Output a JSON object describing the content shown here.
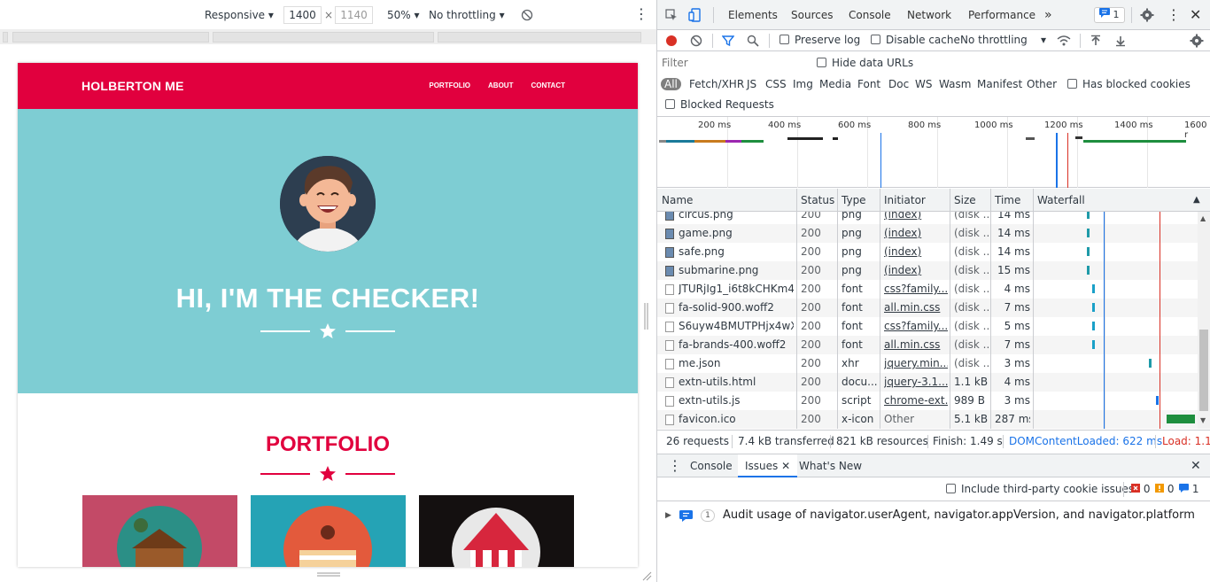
{
  "device_toolbar": {
    "mode": "Responsive",
    "width": "1400",
    "height": "1140",
    "times": "×",
    "zoom": "50%",
    "throttling": "No throttling"
  },
  "site": {
    "brand": "HOLBERTON ME",
    "nav": [
      "PORTFOLIO",
      "ABOUT",
      "CONTACT"
    ],
    "hero_title": "HI, I'M THE CHECKER!",
    "portfolio_title": "PORTFOLIO",
    "colors": {
      "primary": "#e1003e",
      "hero": "#7ecdd3"
    }
  },
  "devtools": {
    "tabs": [
      "Elements",
      "Sources",
      "Console",
      "Network",
      "Performance"
    ],
    "active_tab": "Network",
    "more_tabs": "»",
    "issues_badge": "1",
    "toolbar": {
      "preserve_log": "Preserve log",
      "disable_cache": "Disable cache",
      "throttling": "No throttling"
    },
    "filter": {
      "placeholder": "Filter",
      "hide_data_urls": "Hide data URLs",
      "types": [
        "All",
        "Fetch/XHR",
        "JS",
        "CSS",
        "Img",
        "Media",
        "Font",
        "Doc",
        "WS",
        "Wasm",
        "Manifest",
        "Other"
      ],
      "has_blocked_cookies": "Has blocked cookies",
      "blocked_requests": "Blocked Requests"
    },
    "overview_ticks": [
      "200 ms",
      "400 ms",
      "600 ms",
      "800 ms",
      "1000 ms",
      "1200 ms",
      "1400 ms",
      "1600 r"
    ],
    "columns": [
      "Name",
      "Status",
      "Type",
      "Initiator",
      "Size",
      "Time",
      "Waterfall"
    ],
    "rows": [
      {
        "name": "circus.png",
        "status": "200",
        "type": "png",
        "initiator": "(index)",
        "size": "(disk ...",
        "time": "14 ms"
      },
      {
        "name": "game.png",
        "status": "200",
        "type": "png",
        "initiator": "(index)",
        "size": "(disk ...",
        "time": "14 ms"
      },
      {
        "name": "safe.png",
        "status": "200",
        "type": "png",
        "initiator": "(index)",
        "size": "(disk ...",
        "time": "14 ms"
      },
      {
        "name": "submarine.png",
        "status": "200",
        "type": "png",
        "initiator": "(index)",
        "size": "(disk ...",
        "time": "15 ms"
      },
      {
        "name": "JTURjIg1_i6t8kCHKm4...",
        "status": "200",
        "type": "font",
        "initiator": "css?family...",
        "size": "(disk ...",
        "time": "4 ms"
      },
      {
        "name": "fa-solid-900.woff2",
        "status": "200",
        "type": "font",
        "initiator": "all.min.css",
        "size": "(disk ...",
        "time": "7 ms"
      },
      {
        "name": "S6uyw4BMUTPHjx4wX...",
        "status": "200",
        "type": "font",
        "initiator": "css?family...",
        "size": "(disk ...",
        "time": "5 ms"
      },
      {
        "name": "fa-brands-400.woff2",
        "status": "200",
        "type": "font",
        "initiator": "all.min.css",
        "size": "(disk ...",
        "time": "7 ms"
      },
      {
        "name": "me.json",
        "status": "200",
        "type": "xhr",
        "initiator": "jquery.min....",
        "size": "(disk ...",
        "time": "3 ms"
      },
      {
        "name": "extn-utils.html",
        "status": "200",
        "type": "docu...",
        "initiator": "jquery-3.1....",
        "size": "1.1 kB",
        "time": "4 ms"
      },
      {
        "name": "extn-utils.js",
        "status": "200",
        "type": "script",
        "initiator": "chrome-ext...",
        "size": "989 B",
        "time": "3 ms"
      },
      {
        "name": "favicon.ico",
        "status": "200",
        "type": "x-icon",
        "initiator": "Other",
        "size": "5.1 kB",
        "time": "287 ms"
      }
    ],
    "summary": {
      "requests": "26 requests",
      "transferred": "7.4 kB transferred",
      "resources": "821 kB resources",
      "finish": "Finish: 1.49 s",
      "dcl": "DOMContentLoaded: 622 ms",
      "load": "Load: 1.15"
    },
    "drawer": {
      "tabs": [
        "Console",
        "Issues",
        "What's New"
      ],
      "active": "Issues",
      "include_third_party": "Include third-party cookie issues",
      "errors": "0",
      "warnings": "0",
      "info": "1",
      "issue_count": "1",
      "issue_text": "Audit usage of navigator.userAgent, navigator.appVersion, and navigator.platform"
    }
  }
}
